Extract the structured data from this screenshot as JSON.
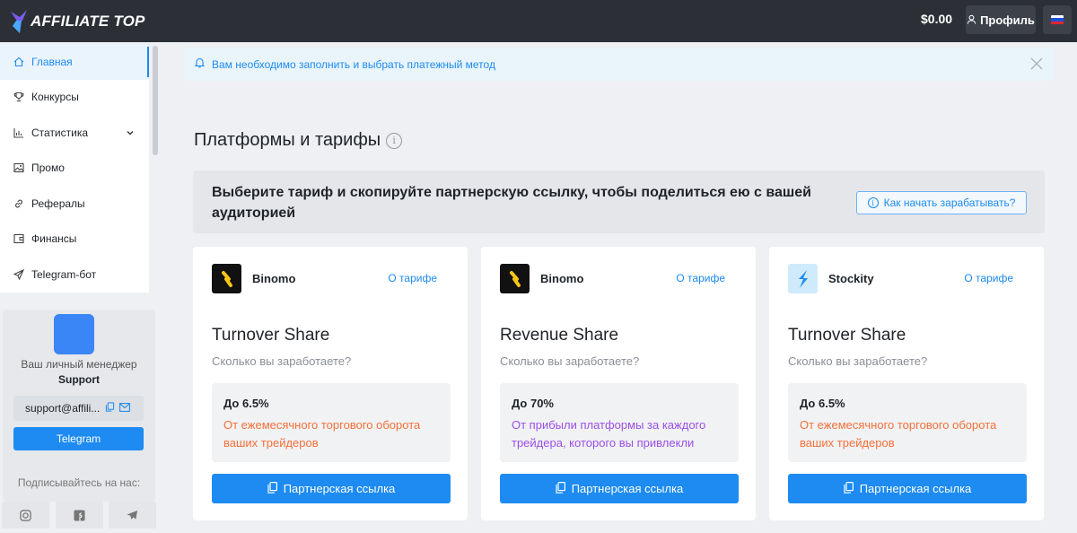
{
  "header": {
    "logo_text": "AFFILIATE TOP",
    "balance": "$0.00",
    "profile_label": "Профиль",
    "language_flag": "russia-flag"
  },
  "sidebar": {
    "items": [
      {
        "label": "Главная",
        "icon": "home-icon",
        "active": true
      },
      {
        "label": "Конкурсы",
        "icon": "trophy-icon",
        "active": false
      },
      {
        "label": "Статистика",
        "icon": "chart-icon",
        "active": false,
        "expandable": true
      },
      {
        "label": "Промо",
        "icon": "image-icon",
        "active": false
      },
      {
        "label": "Рефералы",
        "icon": "link-icon",
        "active": false
      },
      {
        "label": "Финансы",
        "icon": "wallet-icon",
        "active": false
      },
      {
        "label": "Telegram-бот",
        "icon": "send-icon",
        "active": false
      }
    ],
    "manager": {
      "label": "Ваш личный менеджер",
      "name": "Support",
      "email": "support@affili...",
      "telegram_button": "Telegram"
    },
    "subscribe_label": "Подписывайтесь на нас:",
    "socials": [
      "instagram-icon",
      "facebook-icon",
      "telegram-icon"
    ]
  },
  "alert": {
    "text": "Вам необходимо заполнить и выбрать платежный метод"
  },
  "main": {
    "title": "Платформы и тарифы",
    "banner_text": "Выберите тариф и скопируйте партнерскую ссылку, чтобы поделиться ею с вашей аудиторией",
    "how_button": "Как начать зарабатывать?",
    "cards": [
      {
        "platform": "Binomo",
        "about": "О тарифе",
        "plan": "Turnover Share",
        "question": "Сколько вы заработаете?",
        "percent": "До 6.5%",
        "description": "От ежемесячного торгового оборота ваших трейдеров",
        "button": "Партнерская ссылка"
      },
      {
        "platform": "Binomo",
        "about": "О тарифе",
        "plan": "Revenue Share",
        "question": "Сколько вы заработаете?",
        "percent": "До 70%",
        "description": "От прибыли платформы за каждого трейдера, которого вы привлекли",
        "button": "Партнерская ссылка"
      },
      {
        "platform": "Stockity",
        "about": "О тарифе",
        "plan": "Turnover Share",
        "question": "Сколько вы заработаете?",
        "percent": "До 6.5%",
        "description": "От ежемесячного торгового оборота ваших трейдеров",
        "button": "Партнерская ссылка"
      }
    ]
  },
  "colors": {
    "accent": "#1d8bf1",
    "header_bg": "#2c3036",
    "orange_text": "#f4703a",
    "purple_text": "#9b4fe8"
  }
}
